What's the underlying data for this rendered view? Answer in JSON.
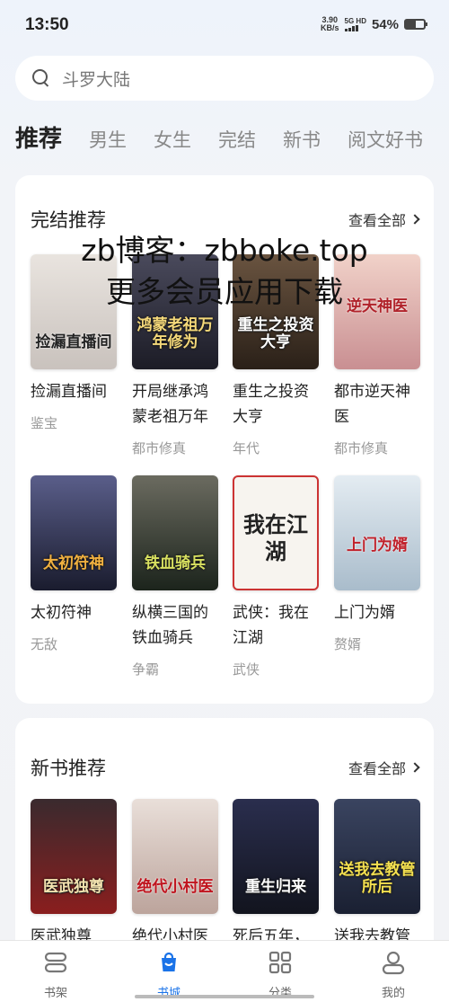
{
  "status": {
    "time": "13:50",
    "net_speed_value": "3.90",
    "net_speed_unit": "KB/s",
    "signal_label": "5G HD",
    "battery": "54%",
    "battery_level": 0.54
  },
  "search": {
    "query": "斗罗大陆"
  },
  "tabs": [
    {
      "label": "推荐"
    },
    {
      "label": "男生"
    },
    {
      "label": "女生"
    },
    {
      "label": "完结"
    },
    {
      "label": "新书"
    },
    {
      "label": "阅文好书"
    }
  ],
  "watermark": {
    "line1": "zb博客：zbboke.top",
    "line2": "更多会员应用下载"
  },
  "sections": [
    {
      "title": "完结推荐",
      "more": "查看全部",
      "books": [
        {
          "title": "捡漏直播间",
          "tag": "鉴宝",
          "cover_text": "捡漏直播间",
          "cover_color": "#c9c2bd"
        },
        {
          "title": "开局继承鸿蒙老祖万年",
          "tag": "都市修真",
          "cover_text": "鸿蒙老祖万年修为",
          "cover_color": "#2a2a38"
        },
        {
          "title": "重生之投资大亨",
          "tag": "年代",
          "cover_text": "重生之投资大亨",
          "cover_color": "#3a3028"
        },
        {
          "title": "都市逆天神医",
          "tag": "都市修真",
          "cover_text": "逆天神医",
          "cover_color": "#d9aeb0"
        },
        {
          "title": "太初符神",
          "tag": "无敌",
          "cover_text": "太初符神",
          "cover_color": "#2c2f4a"
        },
        {
          "title": "纵横三国的铁血骑兵",
          "tag": "争霸",
          "cover_text": "铁血骑兵",
          "cover_color": "#2e3a2c"
        },
        {
          "title": "武侠：我在江湖",
          "tag": "武侠",
          "cover_text": "我在江湖",
          "cover_color": "#f4f1ec"
        },
        {
          "title": "上门为婿",
          "tag": "赘婿",
          "cover_text": "上门为婿",
          "cover_color": "#c7d4e0"
        }
      ]
    },
    {
      "title": "新书推荐",
      "more": "查看全部",
      "books": [
        {
          "title": "医武独尊",
          "cover_text": "医武独尊",
          "cover_color": "#5a1c1c"
        },
        {
          "title": "绝代小村医",
          "cover_text": "绝代小村医",
          "cover_color": "#d8c8c2"
        },
        {
          "title": "死后五年，带",
          "cover_text": "重生归来",
          "cover_color": "#1e2236"
        },
        {
          "title": "送我去教管",
          "cover_text": "送我去教管所后",
          "cover_color": "#2a3248"
        }
      ]
    }
  ],
  "bottom_nav": [
    {
      "label": "书架",
      "icon": "bookshelf-icon"
    },
    {
      "label": "书城",
      "icon": "bookstore-icon",
      "active": true
    },
    {
      "label": "分类",
      "icon": "category-icon"
    },
    {
      "label": "我的",
      "icon": "profile-icon"
    }
  ],
  "colors": {
    "accent": "#1a73e8"
  }
}
